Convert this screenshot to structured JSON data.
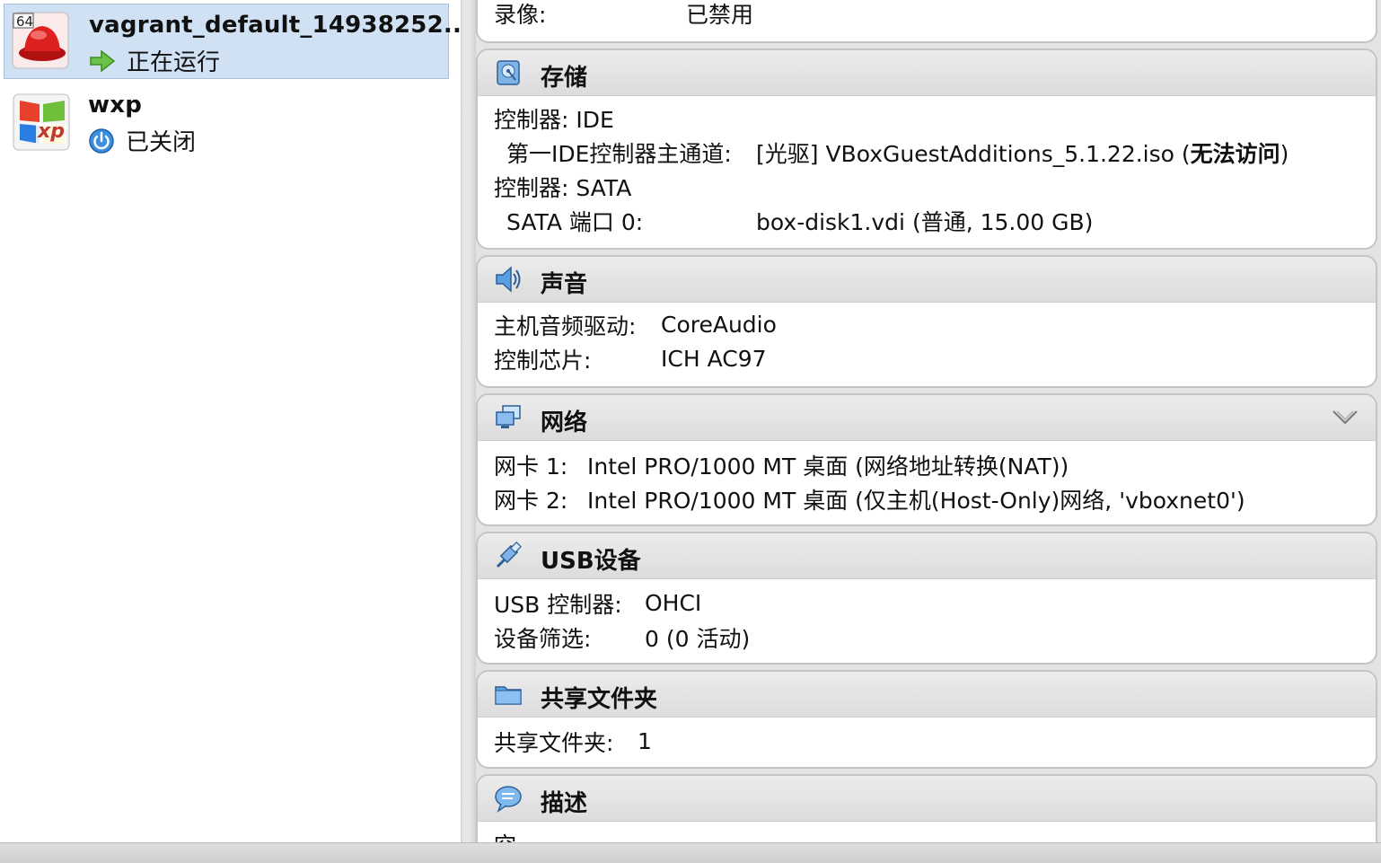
{
  "vm_list": [
    {
      "name": "vagrant_default_14938252...",
      "state": "正在运行",
      "badge": "64",
      "state_icon": "running-arrow-icon"
    },
    {
      "name": "wxp",
      "state": "已关闭",
      "badge": "xp",
      "state_icon": "power-off-icon"
    }
  ],
  "details": {
    "recording": {
      "label": "录像:",
      "value": "已禁用"
    },
    "storage": {
      "title": "存储",
      "rows": [
        {
          "label": "控制器: IDE",
          "value": ""
        },
        {
          "label": "第一IDE控制器主通道:",
          "value_prefix": "[光驱] VBoxGuestAdditions_5.1.22.iso (",
          "value_bold": "无法访问",
          "value_suffix": ")"
        },
        {
          "label": "控制器: SATA",
          "value": ""
        },
        {
          "label": "SATA 端口 0:",
          "value": "box-disk1.vdi (普通, 15.00 GB)"
        }
      ]
    },
    "audio": {
      "title": "声音",
      "rows": [
        {
          "label": "主机音频驱动:",
          "value": "CoreAudio"
        },
        {
          "label": "控制芯片:",
          "value": "ICH AC97"
        }
      ]
    },
    "network": {
      "title": "网络",
      "rows": [
        {
          "label": "网卡 1:",
          "value": "Intel PRO/1000 MT 桌面 (网络地址转换(NAT))"
        },
        {
          "label": "网卡 2:",
          "value": "Intel PRO/1000 MT 桌面 (仅主机(Host-Only)网络, 'vboxnet0')"
        }
      ]
    },
    "usb": {
      "title": "USB设备",
      "rows": [
        {
          "label": "USB 控制器:",
          "value": "OHCI"
        },
        {
          "label": "设备筛选:",
          "value": "0 (0 活动)"
        }
      ]
    },
    "shared": {
      "title": "共享文件夹",
      "rows": [
        {
          "label": "共享文件夹:",
          "value": "1"
        }
      ]
    },
    "description": {
      "title": "描述",
      "rows": [
        {
          "label": "空",
          "value": ""
        }
      ]
    }
  },
  "colors": {
    "selection_bg": "#cfe1f3",
    "section_header": "#e0e0e0",
    "panel_bg": "#e3e3e3"
  }
}
